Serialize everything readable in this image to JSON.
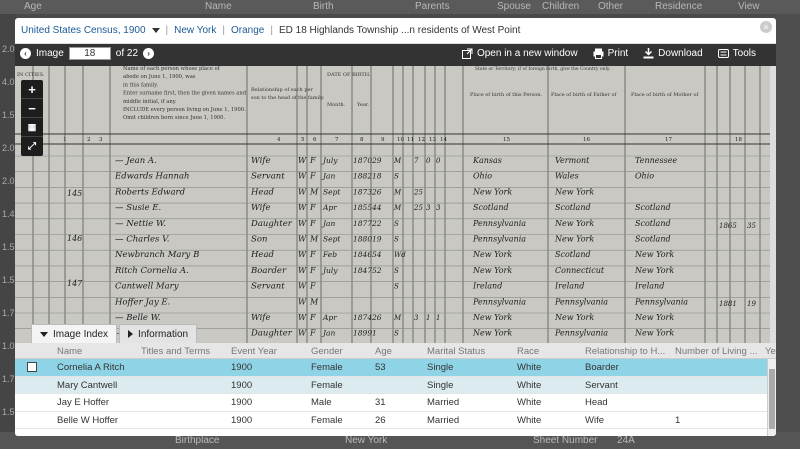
{
  "bg": {
    "header": [
      "Age",
      "Name",
      "Birth",
      "Parents",
      "Spouse",
      "Children",
      "Other",
      "Residence",
      "View"
    ],
    "left_rows": [
      "2.0",
      "4.0",
      "1.5",
      "2.0",
      "2.0",
      "1.4",
      "1.5",
      "1.5",
      "1.7",
      "1.0",
      "1.7",
      "1.5"
    ],
    "bottom": {
      "label1": "Birthplace",
      "value1": "New York",
      "label2": "Sheet Number",
      "value2": "24A"
    }
  },
  "breadcrumbs": {
    "collection": "United States Census, 1900",
    "state": "New York",
    "county": "Orange",
    "location": "ED 18 Highlands Township ...n residents of West Point"
  },
  "close": "×",
  "toolbar": {
    "image_label": "Image",
    "image_number": "18",
    "of_label": "of 22",
    "open_new_window": "Open in a new window",
    "print": "Print",
    "download": "Download",
    "tools": "Tools"
  },
  "zoom": {
    "in": "+",
    "out": "−"
  },
  "tabs": {
    "image_index": "Image Index",
    "information": "Information"
  },
  "table": {
    "columns": [
      "Name",
      "Titles and Terms",
      "Event Year",
      "Gender",
      "Age",
      "Marital Status",
      "Race",
      "Relationship to H...",
      "Number of Living ...",
      "Ye"
    ],
    "rows": [
      {
        "name": "Cornelia A Ritch",
        "titles": "",
        "year": "1900",
        "gender": "Female",
        "age": "53",
        "marital": "Single",
        "race": "White",
        "relationship": "Boarder",
        "living": ""
      },
      {
        "name": "Mary Cantwell",
        "titles": "",
        "year": "1900",
        "gender": "Female",
        "age": "",
        "marital": "Single",
        "race": "White",
        "relationship": "Servant",
        "living": ""
      },
      {
        "name": "Jay E Hoffer",
        "titles": "",
        "year": "1900",
        "gender": "Male",
        "age": "31",
        "marital": "Married",
        "race": "White",
        "relationship": "Head",
        "living": ""
      },
      {
        "name": "Belle W Hoffer",
        "titles": "",
        "year": "1900",
        "gender": "Female",
        "age": "26",
        "marital": "Married",
        "race": "White",
        "relationship": "Wife",
        "living": "1"
      }
    ]
  },
  "census": {
    "header_left": [
      "Name of each person whose place of",
      "abode on June 1, 1900, was",
      "in this family.",
      "Enter surname first, then the given names and",
      "middle initial, if any.",
      "INCLUDE every person living on June 1, 1900.",
      "Omit children born since June 1, 1900."
    ],
    "col_titles": {
      "relationship": "Relationship of each person to the head of the family.",
      "birth": "DATE OF BIRTH.",
      "month": "Month.",
      "year": "Year.",
      "place_person": "Place of birth of this Person.",
      "place_father": "Place of birth of Father of this person.",
      "place_mother": "Place of birth of Mother of this person.",
      "nativity_note": "State or Territory; if of foreign birth, give the Country only.",
      "in_cities": "IN CITIES."
    },
    "col_numbers": [
      "1",
      "2",
      "3",
      "4",
      "5",
      "6",
      "7",
      "8",
      "9",
      "10",
      "11",
      "12",
      "13",
      "14",
      "15",
      "16",
      "17",
      "18"
    ],
    "entries": [
      {
        "name": "— Jean A.",
        "rel": "Wife",
        "c": "W",
        "s": "F",
        "m": "July",
        "y": "1870",
        "a": "29",
        "ms": "M",
        "yr": "7",
        "b": "0",
        "l": "0",
        "p": "Kansas",
        "f": "Vermont",
        "mo": "Tennessee"
      },
      {
        "name": "Edwards Hannah",
        "rel": "Servant",
        "c": "W",
        "s": "F",
        "m": "Jan",
        "y": "1882",
        "a": "18",
        "ms": "S",
        "yr": "",
        "b": "",
        "l": "",
        "p": "Ohio",
        "f": "Wales",
        "mo": "Ohio"
      },
      {
        "name": "Roberts Edward",
        "rel": "Head",
        "c": "W",
        "s": "M",
        "m": "Sept",
        "y": "1873",
        "a": "26",
        "ms": "M",
        "yr": "25",
        "b": "",
        "l": "",
        "p": "New York",
        "f": "New York",
        "mo": ""
      },
      {
        "name": "— Susie E.",
        "rel": "Wife",
        "c": "W",
        "s": "F",
        "m": "Apr",
        "y": "1855",
        "a": "44",
        "ms": "M",
        "yr": "25",
        "b": "3",
        "l": "3",
        "p": "Scotland",
        "f": "Scotland",
        "mo": "Scotland"
      },
      {
        "name": "— Nettie W.",
        "rel": "Daughter",
        "c": "W",
        "s": "F",
        "m": "Jan",
        "y": "1877",
        "a": "22",
        "ms": "S",
        "yr": "",
        "b": "",
        "l": "",
        "p": "Pennsylvania",
        "f": "New York",
        "mo": "Scotland"
      },
      {
        "name": "— Charles V.",
        "rel": "Son",
        "c": "W",
        "s": "M",
        "m": "Sept",
        "y": "1880",
        "a": "19",
        "ms": "S",
        "yr": "",
        "b": "",
        "l": "",
        "p": "Pennsylvania",
        "f": "New York",
        "mo": "Scotland"
      },
      {
        "name": "Newbranch Mary B",
        "rel": "Head",
        "c": "W",
        "s": "F",
        "m": "Feb",
        "y": "1846",
        "a": "54",
        "ms": "Wd",
        "yr": "",
        "b": "",
        "l": "",
        "p": "New York",
        "f": "Scotland",
        "mo": "New York"
      },
      {
        "name": "Ritch Cornelia A.",
        "rel": "Boarder",
        "c": "W",
        "s": "F",
        "m": "July",
        "y": "1847",
        "a": "52",
        "ms": "S",
        "yr": "",
        "b": "",
        "l": "",
        "p": "New York",
        "f": "Connecticut",
        "mo": "New York"
      },
      {
        "name": "Cantwell Mary",
        "rel": "Servant",
        "c": "W",
        "s": "F",
        "m": "",
        "y": "",
        "a": "",
        "ms": "S",
        "yr": "",
        "b": "",
        "l": "",
        "p": "Ireland",
        "f": "Ireland",
        "mo": "Ireland"
      },
      {
        "name": "Hoffer Jay E.",
        "rel": "",
        "c": "W",
        "s": "M",
        "m": "",
        "y": "",
        "a": "",
        "ms": "",
        "yr": "",
        "b": "",
        "l": "",
        "p": "Pennsylvania",
        "f": "Pennsylvania",
        "mo": "Pennsylvania"
      },
      {
        "name": "— Belle W.",
        "rel": "Wife",
        "c": "W",
        "s": "F",
        "m": "Apr",
        "y": "1874",
        "a": "26",
        "ms": "M",
        "yr": "3",
        "b": "1",
        "l": "1",
        "p": "New York",
        "f": "New York",
        "mo": "New York"
      },
      {
        "name": "— ",
        "rel": "Daughter",
        "c": "W",
        "s": "F",
        "m": "Jan",
        "y": "1899",
        "a": "1",
        "ms": "S",
        "yr": "",
        "b": "",
        "l": "",
        "p": "New York",
        "f": "Pennsylvania",
        "mo": "New York"
      }
    ],
    "dwelling_marks": [
      "145",
      "146",
      "147"
    ],
    "right_margin": [
      "1865",
      "35",
      "1881",
      "19"
    ]
  }
}
